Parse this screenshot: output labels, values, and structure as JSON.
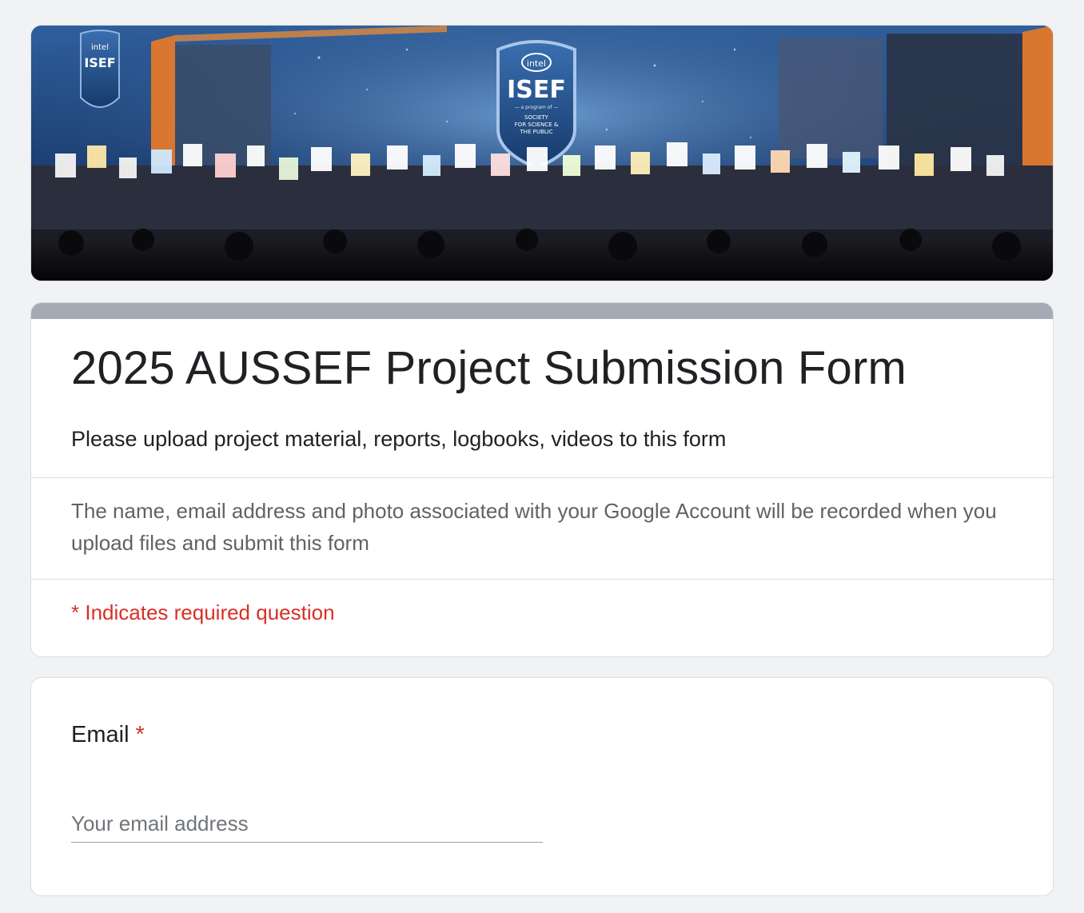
{
  "banner": {
    "image_name": "isef-stage-banner",
    "logo_text": {
      "brand": "intel",
      "name": "ISEF",
      "program_line": "— a program of —",
      "society_line_1": "SOCIETY",
      "society_line_2": "FOR SCIENCE &",
      "society_line_3": "THE PUBLIC"
    }
  },
  "form": {
    "title": "2025 AUSSEF Project Submission Form",
    "description": "Please upload project material, reports, logbooks, videos to this form",
    "account_notice": "The name, email address and photo associated with your Google Account will be recorded when you upload files and submit this form",
    "required_note": "* Indicates required question",
    "header_bar_color": "#a4abb5"
  },
  "questions": [
    {
      "label": "Email",
      "required_marker": "*",
      "placeholder": "Your email address",
      "value": ""
    }
  ],
  "colors": {
    "background": "#f0f2f4",
    "required": "#d93025",
    "text": "#202124",
    "muted": "#5f6368"
  }
}
